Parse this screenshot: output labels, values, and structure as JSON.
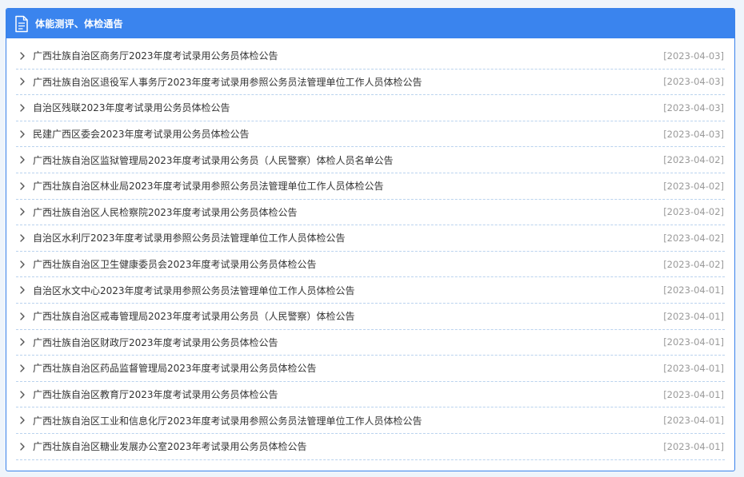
{
  "panel": {
    "title": "体能测评、体检通告",
    "header_icon": "document-icon",
    "accent_color": "#3a84ee"
  },
  "items": [
    {
      "title": "广西壮族自治区商务厅2023年度考试录用公务员体检公告",
      "date": "[2023-04-03]"
    },
    {
      "title": "广西壮族自治区退役军人事务厅2023年度考试录用参照公务员法管理单位工作人员体检公告",
      "date": "[2023-04-03]"
    },
    {
      "title": "自治区残联2023年度考试录用公务员体检公告",
      "date": "[2023-04-03]"
    },
    {
      "title": "民建广西区委会2023年度考试录用公务员体检公告",
      "date": "[2023-04-03]"
    },
    {
      "title": "广西壮族自治区监狱管理局2023年度考试录用公务员（人民警察）体检人员名单公告",
      "date": "[2023-04-02]"
    },
    {
      "title": "广西壮族自治区林业局2023年度考试录用参照公务员法管理单位工作人员体检公告",
      "date": "[2023-04-02]"
    },
    {
      "title": "广西壮族自治区人民检察院2023年度考试录用公务员体检公告",
      "date": "[2023-04-02]"
    },
    {
      "title": "自治区水利厅2023年度考试录用参照公务员法管理单位工作人员体检公告",
      "date": "[2023-04-02]"
    },
    {
      "title": "广西壮族自治区卫生健康委员会2023年度考试录用公务员体检公告",
      "date": "[2023-04-02]"
    },
    {
      "title": "自治区水文中心2023年度考试录用参照公务员法管理单位工作人员体检公告",
      "date": "[2023-04-01]"
    },
    {
      "title": "广西壮族自治区戒毒管理局2023年度考试录用公务员（人民警察）体检公告",
      "date": "[2023-04-01]"
    },
    {
      "title": "广西壮族自治区财政厅2023年度考试录用公务员体检公告",
      "date": "[2023-04-01]"
    },
    {
      "title": "广西壮族自治区药品监督管理局2023年度考试录用公务员体检公告",
      "date": "[2023-04-01]"
    },
    {
      "title": "广西壮族自治区教育厅2023年度考试录用公务员体检公告",
      "date": "[2023-04-01]"
    },
    {
      "title": "广西壮族自治区工业和信息化厅2023年度考试录用参照公务员法管理单位工作人员体检公告",
      "date": "[2023-04-01]"
    },
    {
      "title": "广西壮族自治区糖业发展办公室2023年考试录用公务员体检公告",
      "date": "[2023-04-01]"
    }
  ]
}
